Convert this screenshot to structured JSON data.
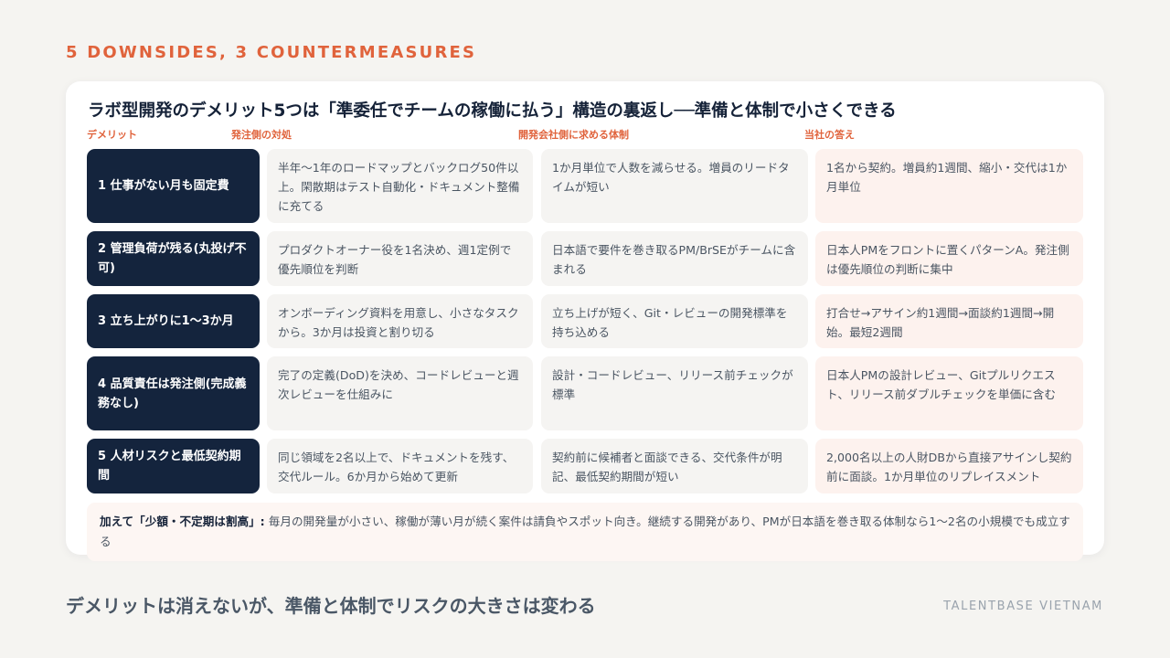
{
  "eyebrow": "5 DOWNSIDES, 3 COUNTERMEASURES",
  "card": {
    "title": "ラボ型開発のデメリット5つは「準委任でチームの稼働に払う」構造の裏返し──準備と体制で小さくできる",
    "columns": [
      "デメリット",
      "発注側の対処",
      "開発会社側に求める体制",
      "当社の答え"
    ],
    "rows": [
      {
        "label": "1 仕事がない月も固定費",
        "client": "半年〜1年のロードマップとバックログ50件以上。閑散期はテスト自動化・ドキュメント整備に充てる",
        "vendor": "1か月単位で人数を減らせる。増員のリードタイムが短い",
        "answer": "1名から契約。増員約1週間、縮小・交代は1か月単位"
      },
      {
        "label": "2 管理負荷が残る(丸投げ不可)",
        "client": "プロダクトオーナー役を1名決め、週1定例で優先順位を判断",
        "vendor": "日本語で要件を巻き取るPM/BrSEがチームに含まれる",
        "answer": "日本人PMをフロントに置くパターンA。発注側は優先順位の判断に集中"
      },
      {
        "label": "3 立ち上がりに1〜3か月",
        "client": "オンボーディング資料を用意し、小さなタスクから。3か月は投資と割り切る",
        "vendor": "立ち上げが短く、Git・レビューの開発標準を持ち込める",
        "answer": "打合せ→アサイン約1週間→面談約1週間→開始。最短2週間"
      },
      {
        "label": "4 品質責任は発注側(完成義務なし)",
        "client": "完了の定義(DoD)を決め、コードレビューと週次レビューを仕組みに",
        "vendor": "設計・コードレビュー、リリース前チェックが標準",
        "answer": "日本人PMの設計レビュー、Gitプルリクエスト、リリース前ダブルチェックを単価に含む"
      },
      {
        "label": "5 人材リスクと最低契約期間",
        "client": "同じ領域を2名以上で、ドキュメントを残す、交代ルール。6か月から始めて更新",
        "vendor": "契約前に候補者と面談できる、交代条件が明記、最低契約期間が短い",
        "answer": "2,000名以上の人財DBから直接アサインし契約前に面談。1か月単位のリプレイスメント"
      }
    ],
    "note_lead": "加えて「少額・不定期は割高」:",
    "note_body": "毎月の開発量が小さい、稼働が薄い月が続く案件は請負やスポット向き。継続する開発があり、PMが日本語を巻き取る体制なら1〜2名の小規模でも成立する"
  },
  "footer": {
    "message": "デメリットは消えないが、準備と体制でリスクの大きさは変わる",
    "brand": "TALENTBASE VIETNAM"
  }
}
